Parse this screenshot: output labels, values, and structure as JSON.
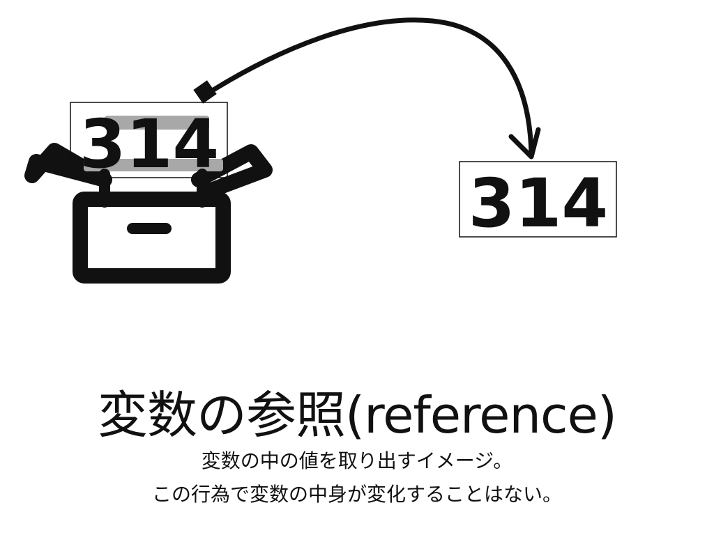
{
  "diagram": {
    "source_value": "314",
    "copied_value": "314"
  },
  "title": "変数の参照(reference)",
  "subtitles": [
    "変数の中の値を取り出すイメージ。",
    "この行為で変数の中身が変化することはない。"
  ],
  "colors": {
    "ink": "#111111",
    "ghost": "#a8a8a8",
    "background": "#ffffff"
  },
  "icons": [
    "open-box-icon",
    "arrow-icon"
  ]
}
